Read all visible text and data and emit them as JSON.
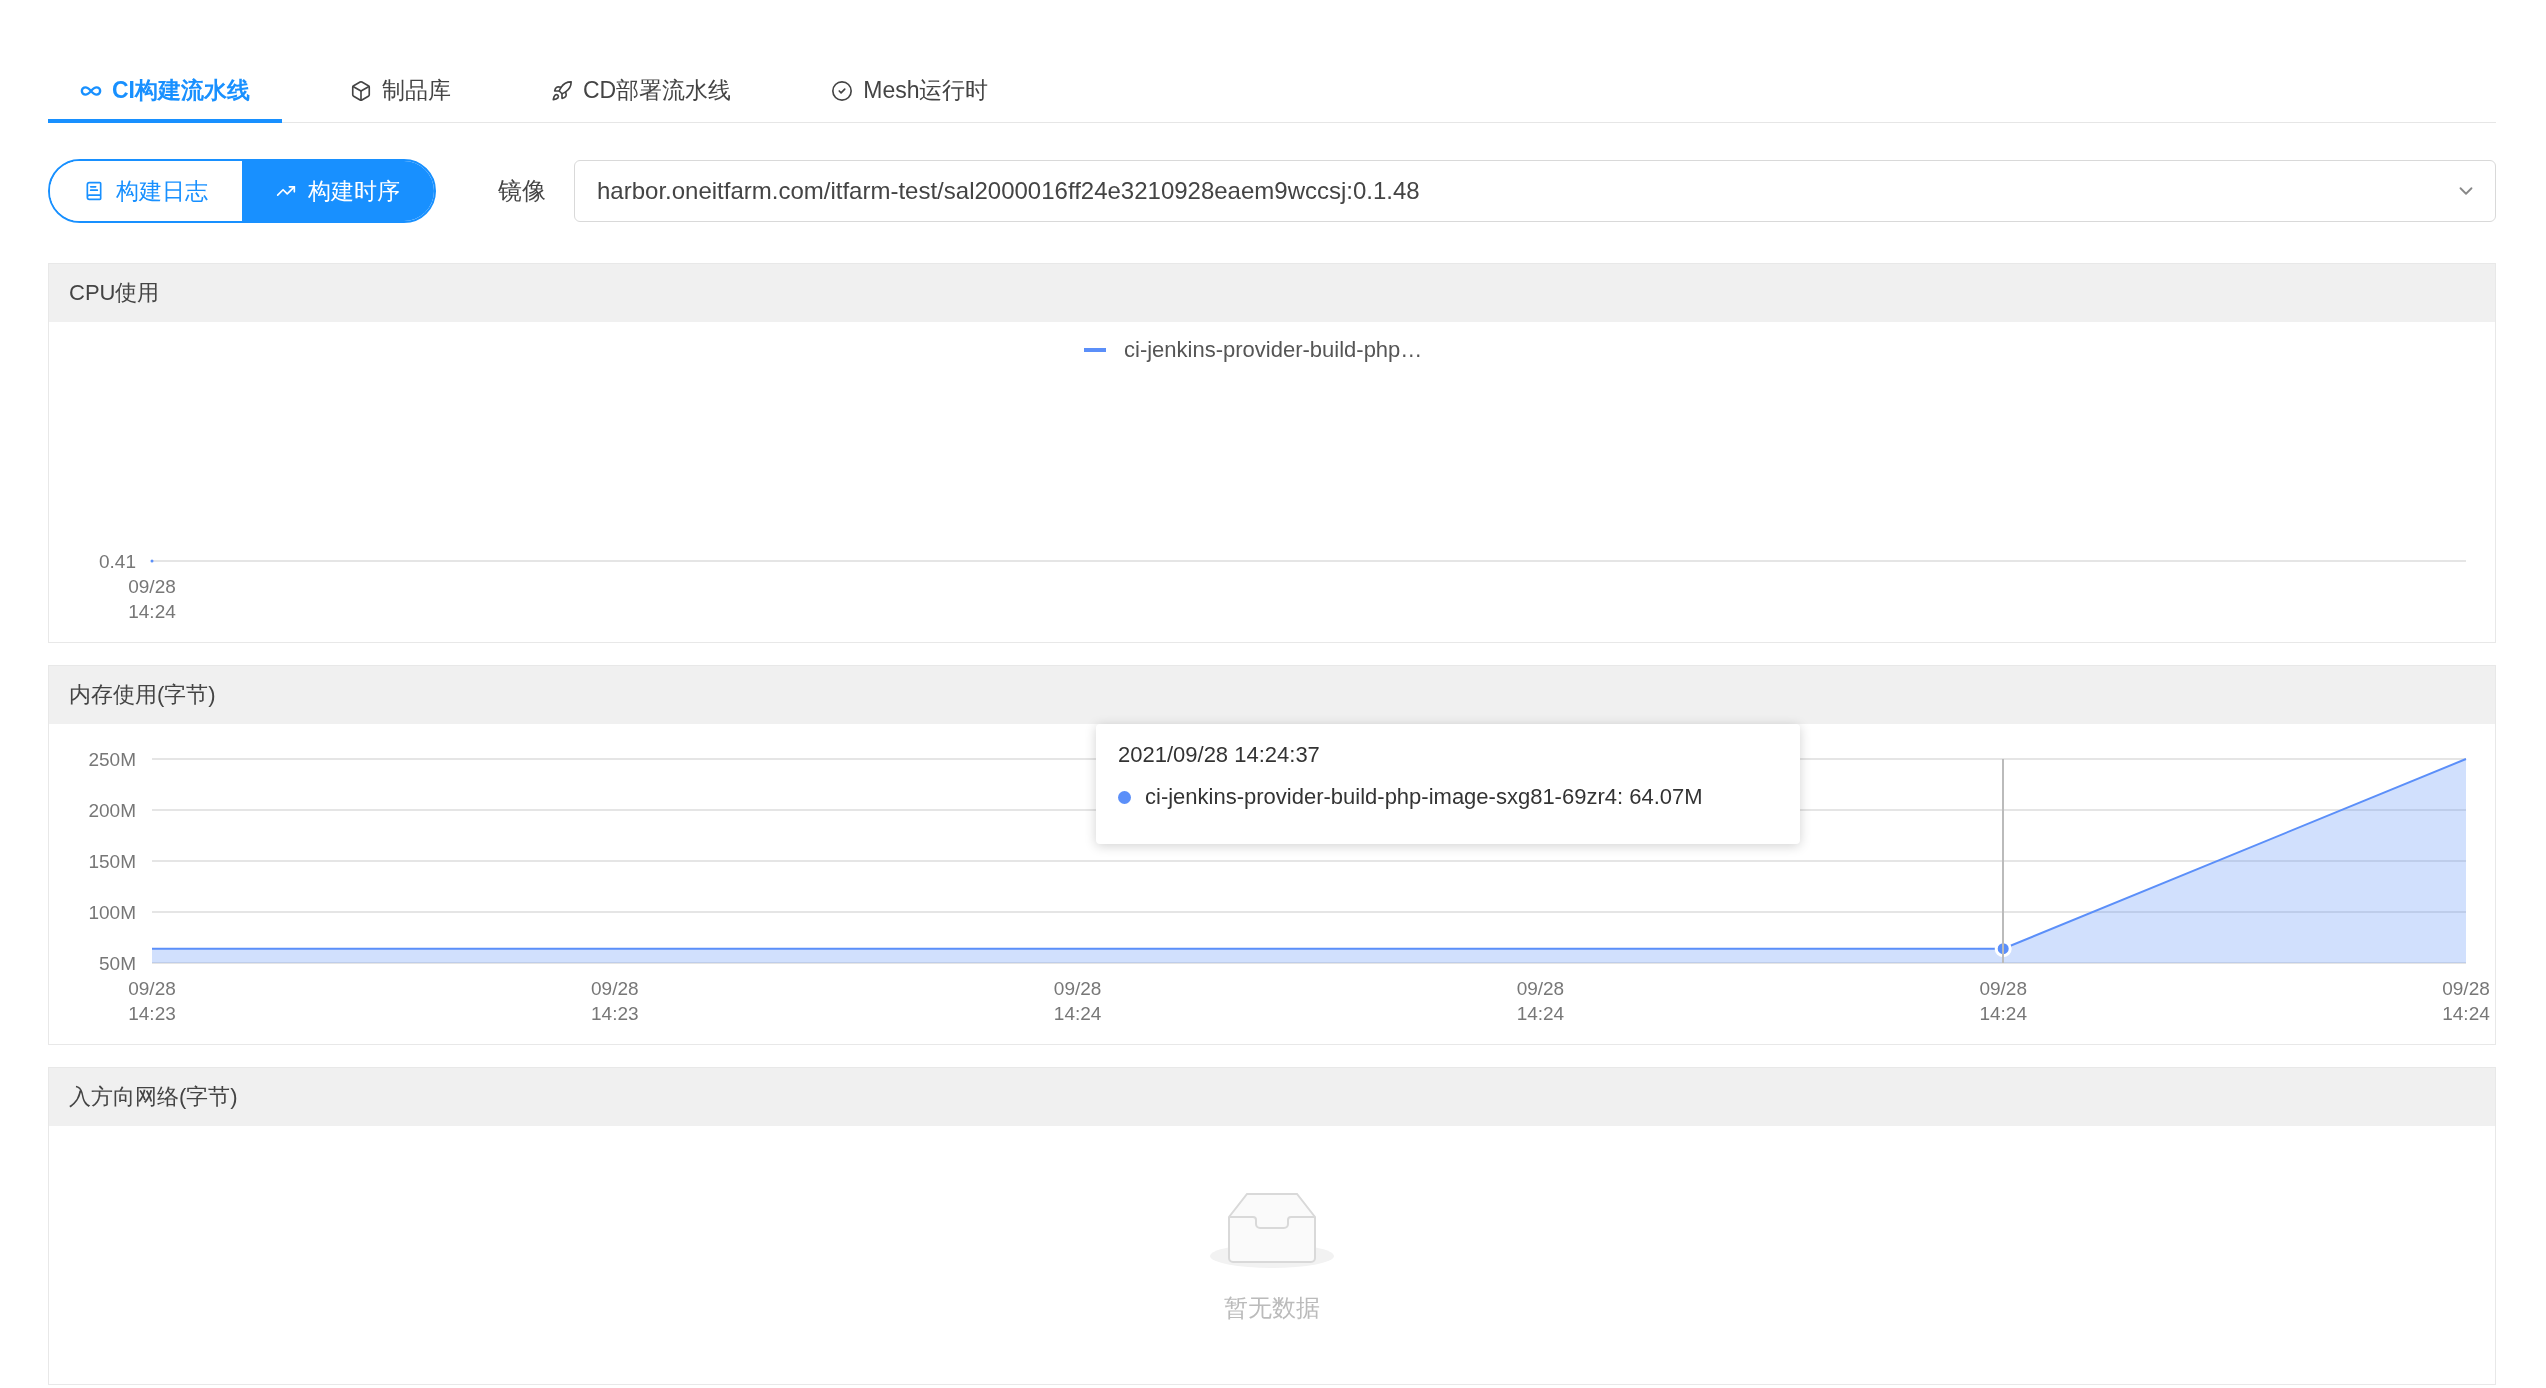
{
  "tabs": [
    {
      "label": "CI构建流水线",
      "selected": true
    },
    {
      "label": "制品库",
      "selected": false
    },
    {
      "label": "CD部署流水线",
      "selected": false
    },
    {
      "label": "Mesh运行时",
      "selected": false
    }
  ],
  "view_toggle": [
    {
      "label": "构建日志",
      "selected": false
    },
    {
      "label": "构建时序",
      "selected": true
    }
  ],
  "image_select": {
    "label": "镜像",
    "value": "harbor.oneitfarm.com/itfarm-test/sal2000016ff24e3210928eaem9wccsj:0.1.48"
  },
  "panels": [
    {
      "title": "CPU使用",
      "kind": "single-point",
      "legend": "ci-jenkins-provider-build-php…",
      "y_label": "0.41",
      "x_label": "09/28 14:24"
    },
    {
      "title": "内存使用(字节)",
      "kind": "chart",
      "chart_data": {
        "type": "area",
        "categories": [
          "09/28 14:23",
          "09/28 14:23",
          "09/28 14:24",
          "09/28 14:24",
          "09/28 14:24",
          "09/28 14:24"
        ],
        "series": [
          {
            "color": "#5b8ff9",
            "values": [
              64,
              64,
              64,
              64,
              64,
              250
            ]
          }
        ],
        "ylim": [
          50,
          250
        ],
        "yticks": [
          {
            "value": 50,
            "label": "50M"
          },
          {
            "value": 100,
            "label": "100M"
          },
          {
            "value": 150,
            "label": "150M"
          },
          {
            "value": 200,
            "label": "200M"
          },
          {
            "value": 250,
            "label": "250M"
          }
        ],
        "grid": true
      },
      "tooltip": {
        "time": "2021/09/28 14:24:37",
        "text": "ci-jenkins-provider-build-php-image-sxg81-69zr4: 64.07M"
      }
    },
    {
      "title": "入方向网络(字节)",
      "kind": "empty",
      "empty_text": "暂无数据"
    }
  ]
}
